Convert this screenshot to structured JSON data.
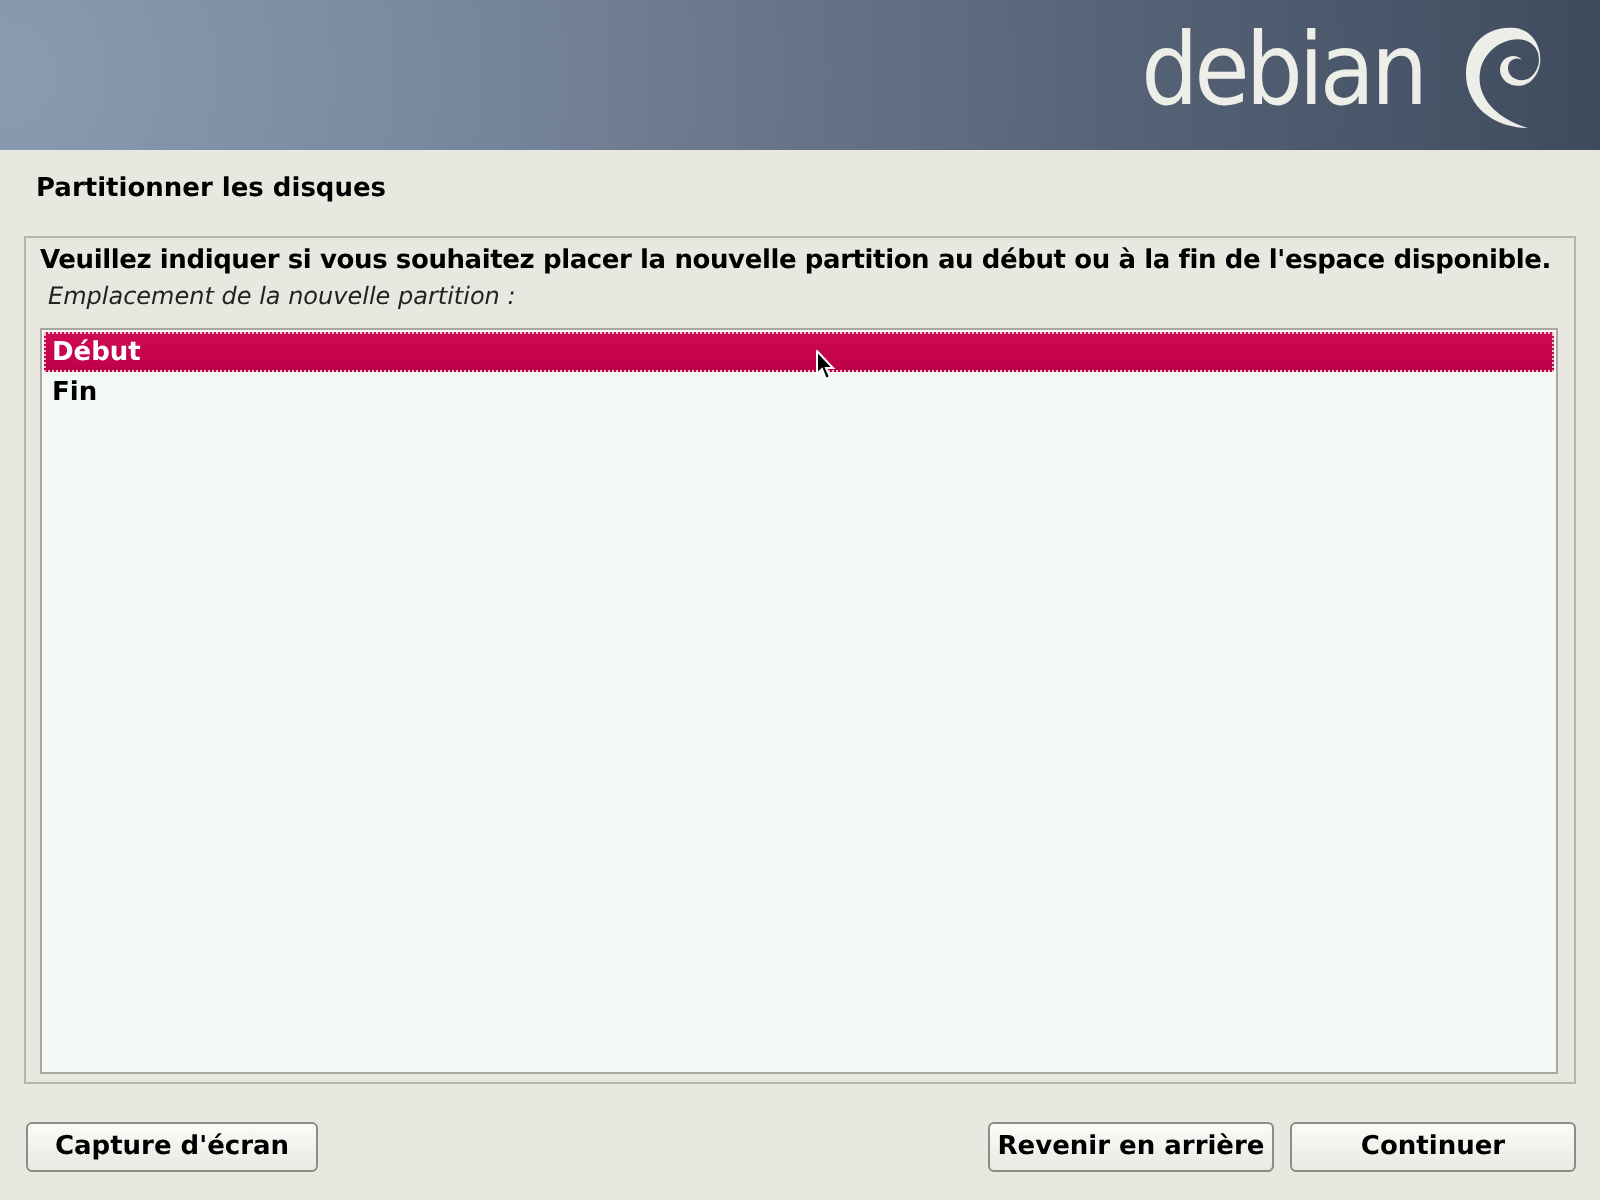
{
  "header": {
    "logo": "debian"
  },
  "title": "Partitionner les disques",
  "question": "Veuillez indiquer si vous souhaitez placer la nouvelle partition au début ou à la fin de l'espace disponible.",
  "list_label": "Emplacement de la nouvelle partition :",
  "options": [
    {
      "label": "Début",
      "selected": true
    },
    {
      "label": "Fin",
      "selected": false
    }
  ],
  "buttons": {
    "left": [
      "Capture d'écran"
    ],
    "right": [
      "Revenir en arrière",
      "Continuer"
    ]
  }
}
